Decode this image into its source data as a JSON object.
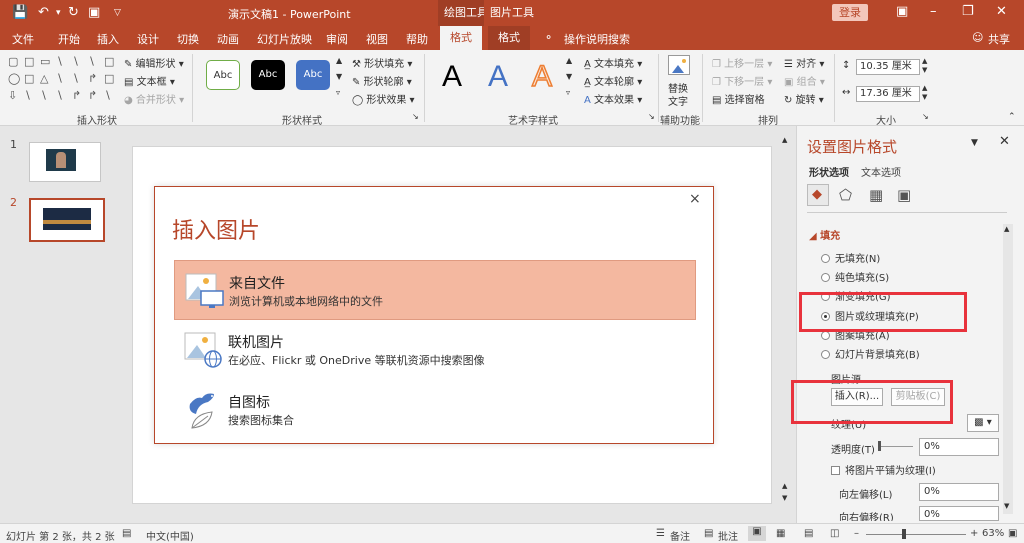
{
  "titlebar": {
    "doc_title": "演示文稿1 - PowerPoint",
    "context_group_drawing": "绘图工具",
    "context_group_picture": "图片工具",
    "login_label": "登录"
  },
  "tabs": {
    "file": "文件",
    "home": "开始",
    "insert": "插入",
    "design": "设计",
    "transitions": "切换",
    "animations": "动画",
    "slideshow": "幻灯片放映",
    "review": "审阅",
    "view": "视图",
    "help": "帮助",
    "format_drawing": "格式",
    "format_picture": "格式",
    "tell_me": "操作说明搜索",
    "share": "共享"
  },
  "ribbon": {
    "edit_shape": "编辑形状",
    "text_box": "文本框",
    "merge_shapes": "合并形状",
    "group_insert_shapes": "插入形状",
    "style_sample": "Abc",
    "shape_fill": "形状填充",
    "shape_outline": "形状轮廓",
    "shape_effects": "形状效果",
    "group_shape_styles": "形状样式",
    "art_letter": "A",
    "text_fill": "文本填充",
    "text_outline": "文本轮廓",
    "text_effects": "文本效果",
    "group_wordart": "艺术字样式",
    "alt_text_line1": "替换",
    "alt_text_line2": "文字",
    "group_accessibility": "辅助功能",
    "bring_forward": "上移一层",
    "send_backward": "下移一层",
    "selection_pane": "选择窗格",
    "align": "对齐",
    "group": "组合",
    "rotate": "旋转",
    "group_arrange": "排列",
    "height_value": "10.35 厘米",
    "width_value": "17.36 厘米",
    "group_size": "大小"
  },
  "thumbs": {
    "num1": "1",
    "num2": "2"
  },
  "dialog": {
    "title": "插入图片",
    "close": "×",
    "opt1_title": "来自文件",
    "opt1_desc": "浏览计算机或本地网络中的文件",
    "opt2_title": "联机图片",
    "opt2_desc": "在必应、Flickr 或 OneDrive 等联机资源中搜索图像",
    "opt3_title": "自图标",
    "opt3_desc": "搜索图标集合"
  },
  "pane": {
    "title": "设置图片格式",
    "tab_shape": "形状选项",
    "tab_text": "文本选项",
    "section_fill": "填充",
    "no_fill": "无填充(N)",
    "solid_fill": "纯色填充(S)",
    "gradient_fill": "渐变填充(G)",
    "picture_fill": "图片或纹理填充(P)",
    "pattern_fill": "图案填充(A)",
    "slide_bg_fill": "幻灯片背景填充(B)",
    "picture_source": "图片源",
    "insert_btn": "插入(R)...",
    "clipboard_btn": "剪贴板(C)",
    "texture": "纹理(U)",
    "transparency": "透明度(T)",
    "transparency_value": "0%",
    "tile_as_texture": "将图片平铺为纹理(I)",
    "offset_left": "向左偏移(L)",
    "offset_left_value": "0%",
    "offset_right": "向右偏移(R)",
    "offset_right_value": "0%"
  },
  "status": {
    "slide_info": "幻灯片 第 2 张，共 2 张",
    "language": "中文(中国)",
    "notes": "备注",
    "comments": "批注",
    "zoom": "63%"
  },
  "colors": {
    "accent": "#b7472a",
    "highlight": "#f4b8a0",
    "annotation_red": "#e8323c"
  }
}
